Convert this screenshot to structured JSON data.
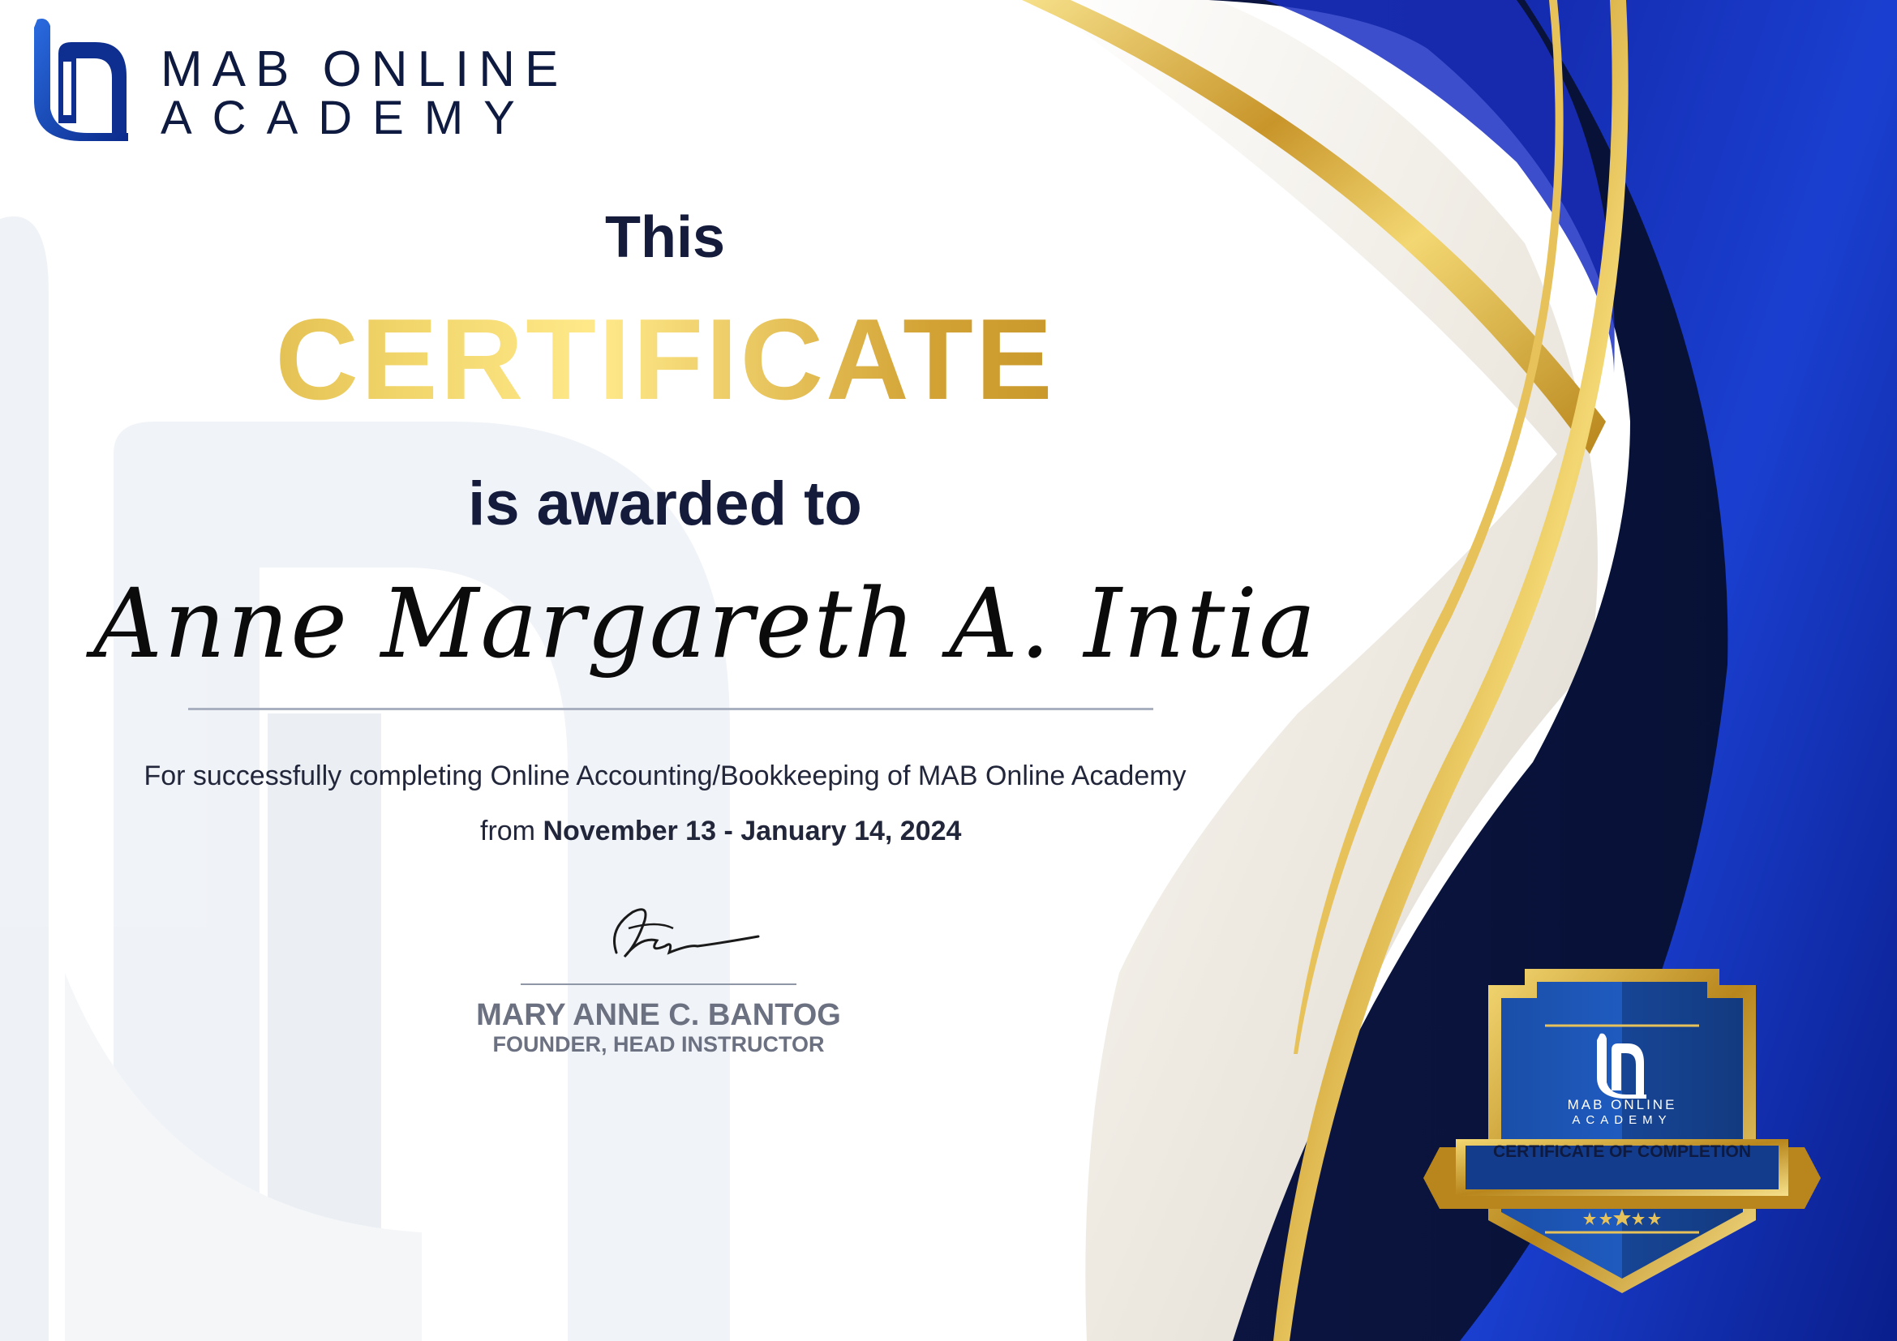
{
  "brand": {
    "line1": "MAB ONLINE",
    "line2": "ACADEMY"
  },
  "certificate": {
    "intro": "This",
    "title": "CERTIFICATE",
    "awarded": "is awarded to",
    "recipient": "Anne Margareth A. Intia",
    "description": "For successfully completing Online Accounting/Bookkeeping of MAB Online Academy",
    "from_label": "from",
    "date_range": "November 13 - January 14, 2024"
  },
  "signatory": {
    "name": "MARY ANNE C. BANTOG",
    "role": "FOUNDER, HEAD INSTRUCTOR"
  },
  "badge": {
    "brand_line1": "MAB ONLINE",
    "brand_line2": "ACADEMY",
    "ribbon": "CERTIFICATE OF COMPLETION",
    "stars": 5
  },
  "colors": {
    "navy": "#0a1747",
    "royal_blue": "#1a3fd0",
    "gold": "#d6a93a",
    "gold_light": "#f3d772",
    "text_dark": "#141b3b"
  },
  "icons": {
    "logo": "mab-academy-logo",
    "signature": "handwritten-signature",
    "badge": "shield-badge"
  }
}
